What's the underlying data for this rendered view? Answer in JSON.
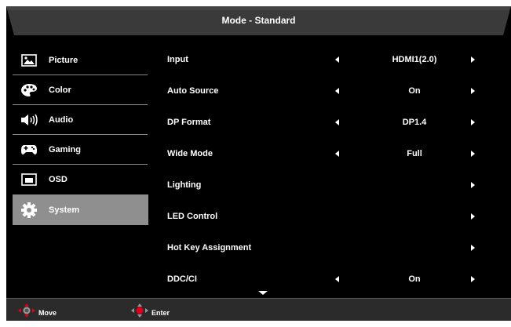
{
  "header": {
    "title": "Mode - Standard"
  },
  "sidebar": {
    "items": [
      {
        "label": "Picture",
        "icon": "picture-icon"
      },
      {
        "label": "Color",
        "icon": "palette-icon"
      },
      {
        "label": "Audio",
        "icon": "speaker-icon"
      },
      {
        "label": "Gaming",
        "icon": "gamepad-icon"
      },
      {
        "label": "OSD",
        "icon": "osd-icon"
      },
      {
        "label": "System",
        "icon": "gear-icon",
        "active": true
      }
    ]
  },
  "main": {
    "rows": [
      {
        "label": "Input",
        "value": "HDMI1(2.0)"
      },
      {
        "label": "Auto Source",
        "value": "On"
      },
      {
        "label": "DP Format",
        "value": "DP1.4"
      },
      {
        "label": "Wide Mode",
        "value": "Full"
      },
      {
        "label": "Lighting",
        "value": ""
      },
      {
        "label": "LED Control",
        "value": ""
      },
      {
        "label": "Hot Key Assignment",
        "value": ""
      },
      {
        "label": "DDC/CI",
        "value": "On"
      }
    ]
  },
  "footer": {
    "move_label": "Move",
    "enter_label": "Enter"
  },
  "colors": {
    "background": "#000000",
    "active_item": "#8f8f8f",
    "header_bar": "#3a3a3a",
    "accent_red": "#e0001b"
  }
}
